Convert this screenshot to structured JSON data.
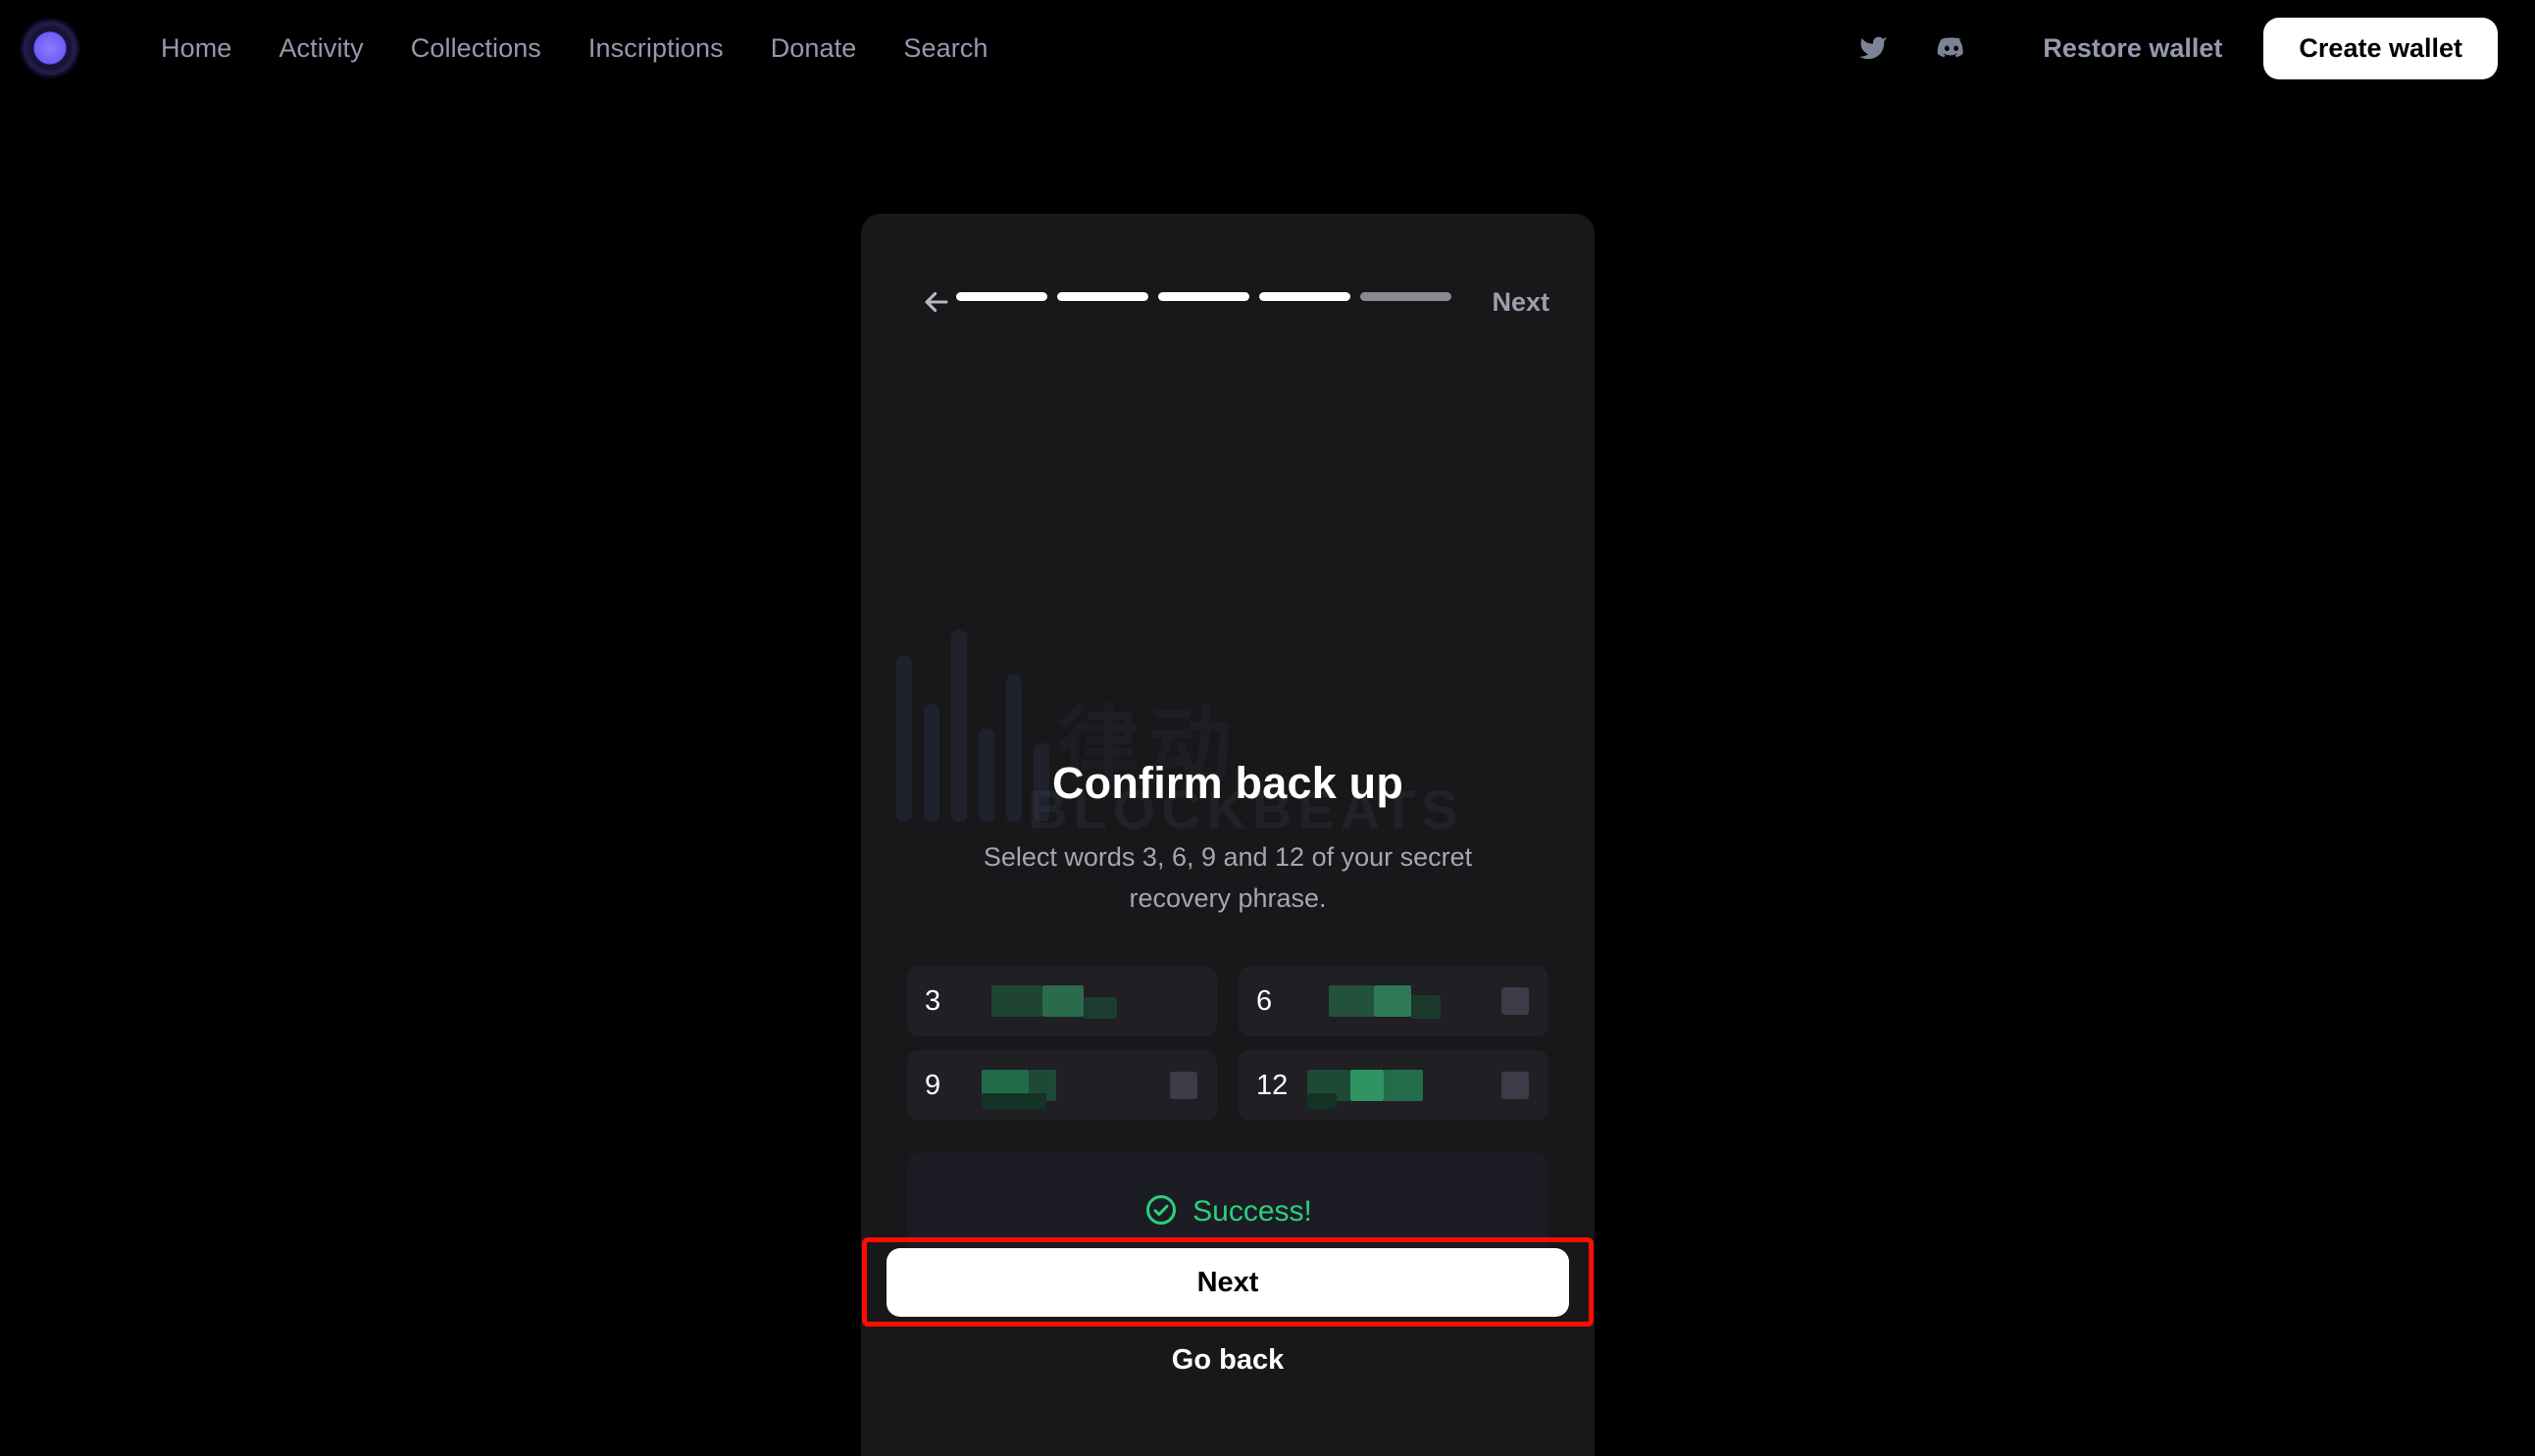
{
  "header": {
    "logo_icon": "gamma-circle-logo",
    "nav": [
      {
        "label": "Home"
      },
      {
        "label": "Activity"
      },
      {
        "label": "Collections"
      },
      {
        "label": "Inscriptions"
      },
      {
        "label": "Donate"
      },
      {
        "label": "Search"
      }
    ],
    "social": [
      {
        "icon": "twitter-icon"
      },
      {
        "icon": "discord-icon"
      }
    ],
    "restore_wallet_label": "Restore wallet",
    "create_wallet_label": "Create wallet"
  },
  "card": {
    "back_icon": "arrow-left-icon",
    "next_link_label": "Next",
    "progress": {
      "total": 5,
      "filled": 4
    },
    "title": "Confirm back up",
    "subtitle": "Select words 3, 6, 9 and 12 of your secret recovery phrase.",
    "words": [
      {
        "index": "3",
        "value": "",
        "redacted": true
      },
      {
        "index": "6",
        "value": "",
        "redacted": true
      },
      {
        "index": "9",
        "value": "",
        "redacted": true
      },
      {
        "index": "12",
        "value": "",
        "redacted": true
      }
    ],
    "status": {
      "icon": "check-circle-icon",
      "text": "Success!",
      "color": "#29d17c"
    },
    "next_button_label": "Next",
    "go_back_label": "Go back"
  },
  "watermark": {
    "cn_text": "律动",
    "en_text": "BLOCKBEATS"
  },
  "annotation": {
    "highlight_color": "#ff0d00",
    "target": "next-button"
  },
  "colors": {
    "background": "#000000",
    "card": "#18181b",
    "accent_white": "#ffffff",
    "success": "#29d17c",
    "muted_text": "#9499ad",
    "logo_violet": "#6d5cf7"
  }
}
